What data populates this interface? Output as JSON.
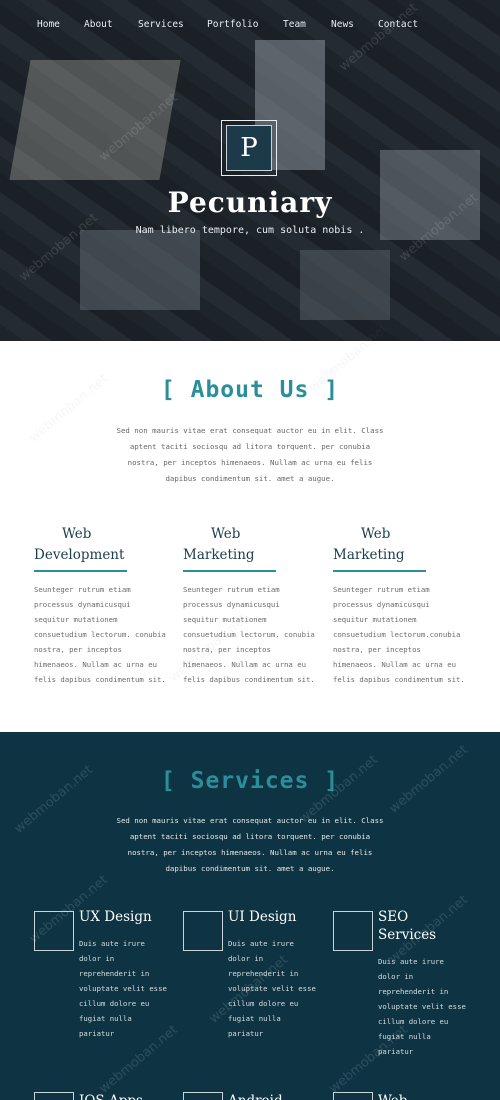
{
  "nav": {
    "items": [
      "Home",
      "About",
      "Services",
      "Portfolio",
      "Team",
      "News",
      "Contact"
    ]
  },
  "hero": {
    "logo_letter": "P",
    "title": "Pecuniary",
    "subtitle": "Nam libero tempore, cum soluta nobis ."
  },
  "about": {
    "title": "[ About Us ]",
    "intro": "Sed non mauris vitae erat consequat auctor eu in elit. Class aptent taciti sociosqu ad litora torquent. per conubia nostra, per inceptos himenaeos. Nullam ac urna eu felis dapibus condimentum sit. amet a augue.",
    "columns": [
      {
        "title_line1": "Web",
        "title_line2": "Development",
        "text": "Seunteger rutrum etiam processus dynamicusqui sequitur mutationem consuetudium lectorum. conubia nostra, per inceptos himenaeos. Nullam ac urna eu felis dapibus condimentum sit."
      },
      {
        "title_line1": "Web",
        "title_line2": "Marketing",
        "text": "Seunteger rutrum etiam processus dynamicusqui sequitur mutationem consuetudium lectorum. conubia nostra, per inceptos himenaeos. Nullam ac urna eu felis dapibus condimentum sit."
      },
      {
        "title_line1": "Web",
        "title_line2": "Marketing",
        "text": "Seunteger rutrum etiam processus dynamicusqui sequitur mutationem consuetudium lectorum.conubia nostra, per inceptos himenaeos. Nullam ac urna eu felis dapibus condimentum sit."
      }
    ]
  },
  "services": {
    "title": "[ Services ]",
    "intro": "Sed non mauris vitae erat consequat auctor eu in elit. Class aptent taciti sociosqu ad litora torquent. per conubia nostra, per inceptos himenaeos. Nullam ac urna eu felis dapibus condimentum sit. amet a augue.",
    "items": [
      {
        "title": "UX Design",
        "text": "Duis aute irure dolor in reprehenderit in voluptate velit esse cillum dolore eu fugiat nulla pariatur"
      },
      {
        "title": "UI Design",
        "text": "Duis aute irure dolor in reprehenderit in voluptate velit esse cillum dolore eu fugiat nulla pariatur"
      },
      {
        "title": "SEO Services",
        "text": "Duis aute irure dolor in reprehenderit in voluptate velit esse cillum dolore eu fugiat nulla pariatur"
      }
    ],
    "row2_titles": [
      "IOS Apps",
      "Android",
      "Web"
    ]
  },
  "watermark": "webmoban.net",
  "colors": {
    "accent": "#2a8f9a",
    "dark": "#0e3443",
    "heading_dark": "#1b3d4c"
  }
}
